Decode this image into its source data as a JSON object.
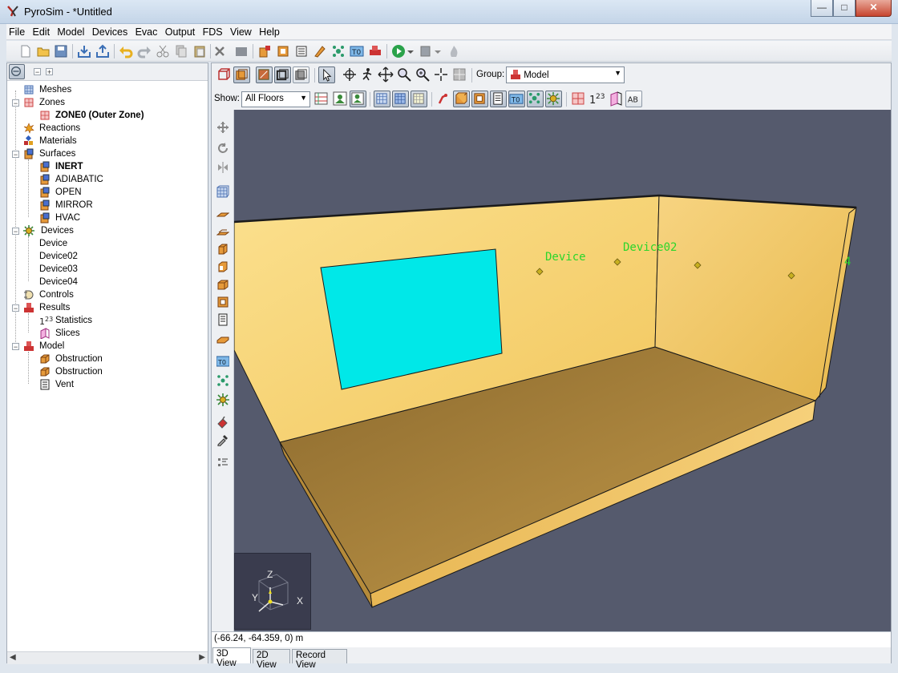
{
  "window": {
    "title": "PyroSim - *Untitled",
    "minimize": "—",
    "maximize": "□",
    "close": "✕"
  },
  "menu": [
    "File",
    "Edit",
    "Model",
    "Devices",
    "Evac",
    "Output",
    "FDS",
    "View",
    "Help"
  ],
  "tree": {
    "meshes": "Meshes",
    "zones": "Zones",
    "zone0": "ZONE0 (Outer Zone)",
    "reactions": "Reactions",
    "materials": "Materials",
    "surfaces": "Surfaces",
    "surface_items": [
      "INERT",
      "ADIABATIC",
      "OPEN",
      "MIRROR",
      "HVAC"
    ],
    "devices": "Devices",
    "device_items": [
      "Device",
      "Device02",
      "Device03",
      "Device04"
    ],
    "controls": "Controls",
    "results": "Results",
    "statistics": "Statistics",
    "slices": "Slices",
    "model": "Model",
    "model_items": [
      "Obstruction",
      "Obstruction",
      "Vent"
    ]
  },
  "view_toolbar": {
    "group_label": "Group:",
    "group_value": "Model",
    "show_label": "Show:",
    "show_value": "All Floors"
  },
  "viewport": {
    "device_labels": [
      "Device",
      "Device02",
      "4"
    ],
    "axis_labels": {
      "z": "Z",
      "y": "Y",
      "x": "X"
    }
  },
  "status": {
    "coordinates": "(-66.24, -64.359, 0) m"
  },
  "tabs": [
    "3D View",
    "2D View",
    "Record View"
  ],
  "colors": {
    "wall": "#f2c968",
    "floor": "#c9a148",
    "vent": "#00e8e8",
    "background": "#555a6d",
    "device_text": "#2bd62b"
  }
}
